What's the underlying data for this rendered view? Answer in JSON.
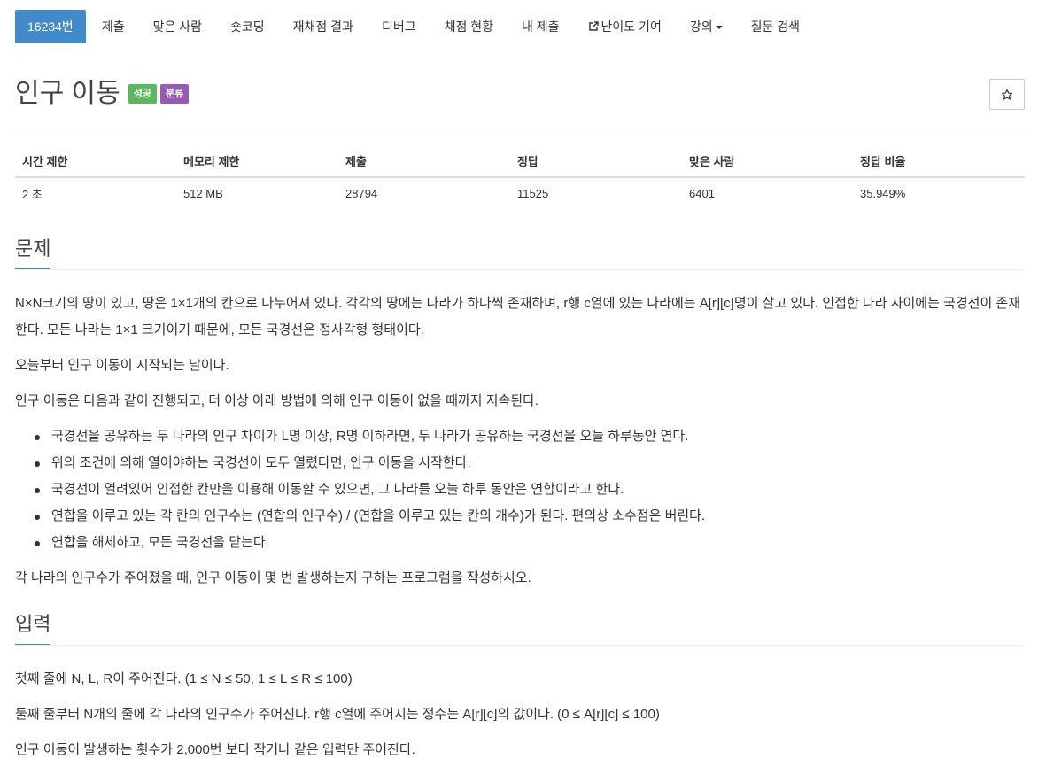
{
  "nav": {
    "items": [
      {
        "label": "16234번",
        "active": true
      },
      {
        "label": "제출"
      },
      {
        "label": "맞은 사람"
      },
      {
        "label": "숏코딩"
      },
      {
        "label": "재채점 결과"
      },
      {
        "label": "디버그"
      },
      {
        "label": "채점 현황"
      },
      {
        "label": "내 제출"
      },
      {
        "label": "난이도 기여",
        "icon": "external-link-icon"
      },
      {
        "label": "강의",
        "icon": "caret-down-icon"
      },
      {
        "label": "질문 검색"
      }
    ]
  },
  "problem": {
    "title": "인구 이동",
    "badges": [
      "성공",
      "분류"
    ],
    "star_icon": "star-outline-icon"
  },
  "info_table": {
    "headers": [
      "시간 제한",
      "메모리 제한",
      "제출",
      "정답",
      "맞은 사람",
      "정답 비율"
    ],
    "values": [
      "2 초",
      "512 MB",
      "28794",
      "11525",
      "6401",
      "35.949%"
    ]
  },
  "description": {
    "heading": "문제",
    "paragraphs": [
      "N×N크기의 땅이 있고, 땅은 1×1개의 칸으로 나누어져 있다. 각각의 땅에는 나라가 하나씩 존재하며, r행 c열에 있는 나라에는 A[r][c]명이 살고 있다. 인접한 나라 사이에는 국경선이 존재한다. 모든 나라는 1×1 크기이기 때문에, 모든 국경선은 정사각형 형태이다.",
      "오늘부터 인구 이동이 시작되는 날이다.",
      "인구 이동은 다음과 같이 진행되고, 더 이상 아래 방법에 의해 인구 이동이 없을 때까지 지속된다."
    ],
    "rules": [
      "국경선을 공유하는 두 나라의 인구 차이가 L명 이상, R명 이하라면, 두 나라가 공유하는 국경선을 오늘 하루동안 연다.",
      "위의 조건에 의해 열어야하는 국경선이 모두 열렸다면, 인구 이동을 시작한다.",
      "국경선이 열려있어 인접한 칸만을 이용해 이동할 수 있으면, 그 나라를 오늘 하루 동안은 연합이라고 한다.",
      "연합을 이루고 있는 각 칸의 인구수는 (연합의 인구수) / (연합을 이루고 있는 칸의 개수)가 된다. 편의상 소수점은 버린다.",
      "연합을 해체하고, 모든 국경선을 닫는다."
    ],
    "closing": "각 나라의 인구수가 주어졌을 때, 인구 이동이 몇 번 발생하는지 구하는 프로그램을 작성하시오."
  },
  "input": {
    "heading": "입력",
    "paragraphs": [
      "첫째 줄에 N, L, R이 주어진다. (1 ≤ N ≤ 50, 1 ≤ L ≤ R ≤ 100)",
      "둘째 줄부터 N개의 줄에 각 나라의 인구수가 주어진다. r행 c열에 주어지는 정수는 A[r][c]의 값이다. (0 ≤ A[r][c] ≤ 100)",
      "인구 이동이 발생하는 횟수가 2,000번 보다 작거나 같은 입력만 주어진다."
    ]
  },
  "colors": {
    "primary": "#428bca",
    "success": "#5cb85c",
    "tag": "#9b59b6"
  }
}
